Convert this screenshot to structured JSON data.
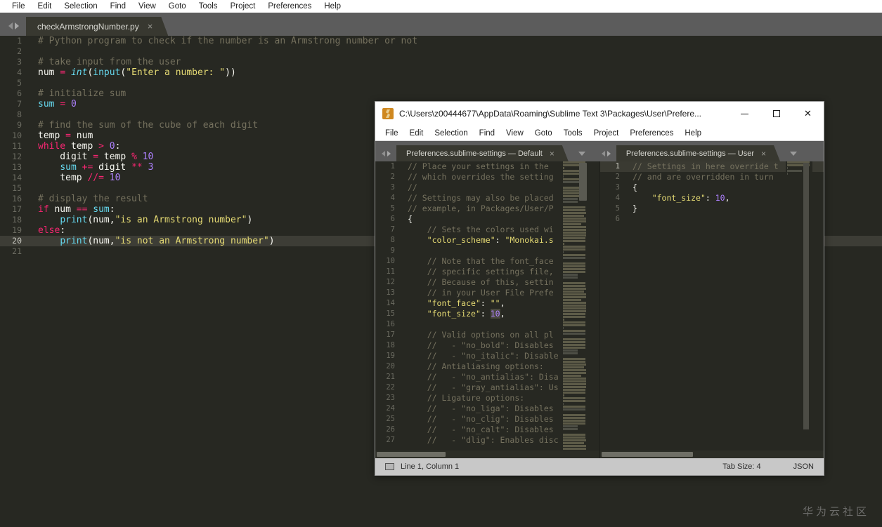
{
  "main_window": {
    "menu": [
      "File",
      "Edit",
      "Selection",
      "Find",
      "View",
      "Goto",
      "Tools",
      "Project",
      "Preferences",
      "Help"
    ],
    "tab": {
      "label": "checkArmstrongNumber.py",
      "close": "×"
    },
    "editor": {
      "current_line": 20,
      "lines": [
        {
          "n": "1",
          "tokens": [
            {
              "t": "# Python program to check if the number is an Armstrong number or not",
              "c": "cmt"
            }
          ]
        },
        {
          "n": "2",
          "tokens": []
        },
        {
          "n": "3",
          "tokens": [
            {
              "t": "# take input from the user",
              "c": "cmt"
            }
          ]
        },
        {
          "n": "4",
          "tokens": [
            {
              "t": "num ",
              "c": "vr"
            },
            {
              "t": "=",
              "c": "op"
            },
            {
              "t": " ",
              "c": "pl"
            },
            {
              "t": "int",
              "c": "bi"
            },
            {
              "t": "(",
              "c": "pl"
            },
            {
              "t": "input",
              "c": "cy"
            },
            {
              "t": "(",
              "c": "pl"
            },
            {
              "t": "\"Enter a number: \"",
              "c": "str"
            },
            {
              "t": "))",
              "c": "pl"
            }
          ]
        },
        {
          "n": "5",
          "tokens": []
        },
        {
          "n": "6",
          "tokens": [
            {
              "t": "# initialize sum",
              "c": "cmt"
            }
          ]
        },
        {
          "n": "7",
          "tokens": [
            {
              "t": "sum",
              "c": "cy"
            },
            {
              "t": " ",
              "c": "pl"
            },
            {
              "t": "=",
              "c": "op"
            },
            {
              "t": " ",
              "c": "pl"
            },
            {
              "t": "0",
              "c": "num"
            }
          ]
        },
        {
          "n": "8",
          "tokens": []
        },
        {
          "n": "9",
          "tokens": [
            {
              "t": "# find the sum of the cube of each digit",
              "c": "cmt"
            }
          ]
        },
        {
          "n": "10",
          "tokens": [
            {
              "t": "temp ",
              "c": "vr"
            },
            {
              "t": "=",
              "c": "op"
            },
            {
              "t": " num",
              "c": "vr"
            }
          ]
        },
        {
          "n": "11",
          "tokens": [
            {
              "t": "while",
              "c": "kw"
            },
            {
              "t": " temp ",
              "c": "vr"
            },
            {
              "t": ">",
              "c": "op"
            },
            {
              "t": " ",
              "c": "pl"
            },
            {
              "t": "0",
              "c": "num"
            },
            {
              "t": ":",
              "c": "pl"
            }
          ]
        },
        {
          "n": "12",
          "tokens": [
            {
              "t": "    digit ",
              "c": "vr"
            },
            {
              "t": "=",
              "c": "op"
            },
            {
              "t": " temp ",
              "c": "vr"
            },
            {
              "t": "%",
              "c": "op"
            },
            {
              "t": " ",
              "c": "pl"
            },
            {
              "t": "10",
              "c": "num"
            }
          ]
        },
        {
          "n": "13",
          "tokens": [
            {
              "t": "    ",
              "c": "pl"
            },
            {
              "t": "sum",
              "c": "cy"
            },
            {
              "t": " ",
              "c": "pl"
            },
            {
              "t": "+=",
              "c": "op"
            },
            {
              "t": " digit ",
              "c": "vr"
            },
            {
              "t": "**",
              "c": "op"
            },
            {
              "t": " ",
              "c": "pl"
            },
            {
              "t": "3",
              "c": "num"
            }
          ]
        },
        {
          "n": "14",
          "tokens": [
            {
              "t": "    temp ",
              "c": "vr"
            },
            {
              "t": "//=",
              "c": "op"
            },
            {
              "t": " ",
              "c": "pl"
            },
            {
              "t": "10",
              "c": "num"
            }
          ]
        },
        {
          "n": "15",
          "tokens": []
        },
        {
          "n": "16",
          "tokens": [
            {
              "t": "# display the result",
              "c": "cmt"
            }
          ]
        },
        {
          "n": "17",
          "tokens": [
            {
              "t": "if",
              "c": "kw"
            },
            {
              "t": " num ",
              "c": "vr"
            },
            {
              "t": "==",
              "c": "op"
            },
            {
              "t": " ",
              "c": "pl"
            },
            {
              "t": "sum",
              "c": "cy"
            },
            {
              "t": ":",
              "c": "pl"
            }
          ]
        },
        {
          "n": "18",
          "tokens": [
            {
              "t": "    ",
              "c": "pl"
            },
            {
              "t": "print",
              "c": "cy"
            },
            {
              "t": "(num,",
              "c": "pl"
            },
            {
              "t": "\"is an Armstrong number\"",
              "c": "str"
            },
            {
              "t": ")",
              "c": "pl"
            }
          ]
        },
        {
          "n": "19",
          "tokens": [
            {
              "t": "else",
              "c": "kw"
            },
            {
              "t": ":",
              "c": "pl"
            }
          ]
        },
        {
          "n": "20",
          "tokens": [
            {
              "t": "    ",
              "c": "pl"
            },
            {
              "t": "print",
              "c": "cy"
            },
            {
              "t": "(num,",
              "c": "pl"
            },
            {
              "t": "\"is not an Armstrong number\"",
              "c": "str"
            },
            {
              "t": ")",
              "c": "pl"
            }
          ]
        },
        {
          "n": "21",
          "tokens": []
        }
      ]
    }
  },
  "inner_window": {
    "title": "C:\\Users\\z00444677\\AppData\\Roaming\\Sublime Text 3\\Packages\\User\\Prefere...",
    "controls": {
      "minimize": "—",
      "maximize": "□",
      "close": "✕"
    },
    "menu": [
      "File",
      "Edit",
      "Selection",
      "Find",
      "View",
      "Goto",
      "Tools",
      "Project",
      "Preferences",
      "Help"
    ],
    "tabs": [
      {
        "label": "Preferences.sublime-settings — Default",
        "close": "×"
      },
      {
        "label": "Preferences.sublime-settings — User",
        "close": "×"
      }
    ],
    "pane_left": {
      "current_line": 0,
      "lines": [
        {
          "n": "1",
          "tokens": [
            {
              "t": "// Place your settings in the ",
              "c": "cmt"
            }
          ]
        },
        {
          "n": "2",
          "tokens": [
            {
              "t": "// which overrides the setting",
              "c": "cmt"
            }
          ]
        },
        {
          "n": "3",
          "tokens": [
            {
              "t": "//",
              "c": "cmt"
            }
          ]
        },
        {
          "n": "4",
          "tokens": [
            {
              "t": "// Settings may also be placed",
              "c": "cmt"
            }
          ]
        },
        {
          "n": "5",
          "tokens": [
            {
              "t": "// example, in Packages/User/P",
              "c": "cmt"
            }
          ]
        },
        {
          "n": "6",
          "tokens": [
            {
              "t": "{",
              "c": "pl"
            }
          ]
        },
        {
          "n": "7",
          "tokens": [
            {
              "t": "    // Sets the colors used wi",
              "c": "cmt"
            }
          ]
        },
        {
          "n": "8",
          "tokens": [
            {
              "t": "    ",
              "c": "pl"
            },
            {
              "t": "\"color_scheme\"",
              "c": "str"
            },
            {
              "t": ": ",
              "c": "pl"
            },
            {
              "t": "\"Monokai.s",
              "c": "str"
            }
          ]
        },
        {
          "n": "9",
          "tokens": []
        },
        {
          "n": "10",
          "tokens": [
            {
              "t": "    // Note that the font_face",
              "c": "cmt"
            }
          ]
        },
        {
          "n": "11",
          "tokens": [
            {
              "t": "    // specific settings file,",
              "c": "cmt"
            }
          ]
        },
        {
          "n": "12",
          "tokens": [
            {
              "t": "    // Because of this, settin",
              "c": "cmt"
            }
          ]
        },
        {
          "n": "13",
          "tokens": [
            {
              "t": "    // in your User File Prefe",
              "c": "cmt"
            }
          ]
        },
        {
          "n": "14",
          "tokens": [
            {
              "t": "    ",
              "c": "pl"
            },
            {
              "t": "\"font_face\"",
              "c": "str"
            },
            {
              "t": ": ",
              "c": "pl"
            },
            {
              "t": "\"\"",
              "c": "str"
            },
            {
              "t": ",",
              "c": "pl"
            }
          ]
        },
        {
          "n": "15",
          "tokens": [
            {
              "t": "    ",
              "c": "pl"
            },
            {
              "t": "\"font_size\"",
              "c": "str"
            },
            {
              "t": ": ",
              "c": "pl"
            },
            {
              "t": "10",
              "c": "num sel"
            },
            {
              "t": ",",
              "c": "pl"
            }
          ]
        },
        {
          "n": "16",
          "tokens": []
        },
        {
          "n": "17",
          "tokens": [
            {
              "t": "    // Valid options on all pl",
              "c": "cmt"
            }
          ]
        },
        {
          "n": "18",
          "tokens": [
            {
              "t": "    //   - \"no_bold\": Disables",
              "c": "cmt"
            }
          ]
        },
        {
          "n": "19",
          "tokens": [
            {
              "t": "    //   - \"no_italic\": Disable",
              "c": "cmt"
            }
          ]
        },
        {
          "n": "20",
          "tokens": [
            {
              "t": "    // Antialiasing options:",
              "c": "cmt"
            }
          ]
        },
        {
          "n": "21",
          "tokens": [
            {
              "t": "    //   - \"no_antialias\": Disa",
              "c": "cmt"
            }
          ]
        },
        {
          "n": "22",
          "tokens": [
            {
              "t": "    //   - \"gray_antialias\": Us",
              "c": "cmt"
            }
          ]
        },
        {
          "n": "23",
          "tokens": [
            {
              "t": "    // Ligature options:",
              "c": "cmt"
            }
          ]
        },
        {
          "n": "24",
          "tokens": [
            {
              "t": "    //   - \"no_liga\": Disables ",
              "c": "cmt"
            }
          ]
        },
        {
          "n": "25",
          "tokens": [
            {
              "t": "    //   - \"no_clig\": Disables ",
              "c": "cmt"
            }
          ]
        },
        {
          "n": "26",
          "tokens": [
            {
              "t": "    //   - \"no_calt\": Disables ",
              "c": "cmt"
            }
          ]
        },
        {
          "n": "27",
          "tokens": [
            {
              "t": "    //   - \"dlig\": Enables disc",
              "c": "cmt"
            }
          ]
        }
      ]
    },
    "pane_right": {
      "current_line": 1,
      "lines": [
        {
          "n": "1",
          "tokens": [
            {
              "t": "// Settings in here override t",
              "c": "cmt"
            }
          ]
        },
        {
          "n": "2",
          "tokens": [
            {
              "t": "// and are overridden in turn ",
              "c": "cmt"
            }
          ]
        },
        {
          "n": "3",
          "tokens": [
            {
              "t": "{",
              "c": "pl"
            }
          ]
        },
        {
          "n": "4",
          "tokens": [
            {
              "t": "    ",
              "c": "pl"
            },
            {
              "t": "\"font_size\"",
              "c": "str"
            },
            {
              "t": ": ",
              "c": "pl"
            },
            {
              "t": "10",
              "c": "num"
            },
            {
              "t": ",",
              "c": "pl"
            }
          ]
        },
        {
          "n": "5",
          "tokens": [
            {
              "t": "}",
              "c": "pl"
            }
          ]
        },
        {
          "n": "6",
          "tokens": []
        }
      ]
    },
    "statusbar": {
      "position": "Line 1, Column 1",
      "tab_size": "Tab Size: 4",
      "syntax": "JSON"
    }
  },
  "watermark": "华为云社区",
  "colors": {
    "editor_bg": "#272822",
    "chrome_bg": "#5c5c5c",
    "tab_active": "#383830",
    "comment": "#75715e",
    "keyword": "#f92672",
    "string": "#e6db74",
    "number": "#ae81ff",
    "builtin": "#66d9ef",
    "statusbar": "#c8c8c8"
  }
}
